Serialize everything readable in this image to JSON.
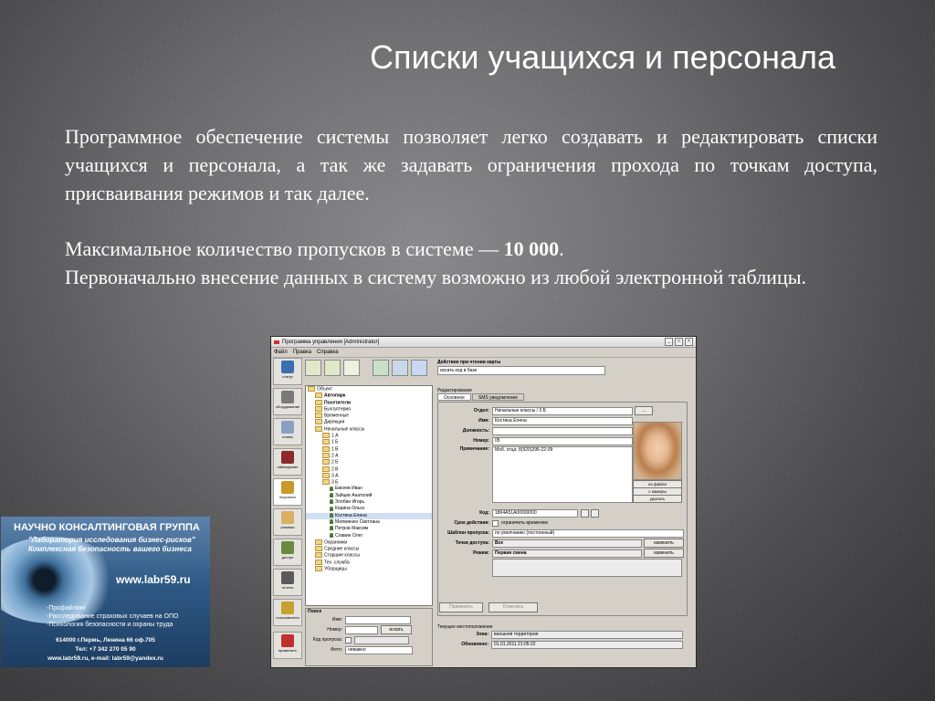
{
  "slide": {
    "title": "Списки учащихся и персонала",
    "paragraph1": "Программное обеспечение системы позволяет легко создавать и редактировать списки учащихся и персонала, а так же задавать ограничения прохода по точкам доступа, присваивания режимов и так далее.",
    "paragraph2_prefix": "Максимальное количество пропусков в системе — ",
    "paragraph2_value": "10 000",
    "paragraph2_suffix": ".",
    "paragraph3": "Первоначально внесение данных в систему возможно из любой электронной таблицы."
  },
  "app": {
    "window_title": "Программа управления [Administrator]",
    "window_buttons": [
      "_",
      "□",
      "×"
    ],
    "menu": [
      "Файл",
      "Правка",
      "Справка"
    ],
    "sidebar": [
      {
        "label": "статус",
        "icon": "status-icon",
        "color": "#3a6fb0"
      },
      {
        "label": "оборудование",
        "icon": "equipment-icon",
        "color": "#7a7a7a"
      },
      {
        "label": "планы",
        "icon": "plans-icon",
        "color": "#8aa0c0"
      },
      {
        "label": "наблюдение",
        "icon": "camera-icon",
        "color": "#8b2a2a"
      },
      {
        "label": "персонал",
        "icon": "people-icon",
        "color": "#c89a2a"
      },
      {
        "label": "режимы",
        "icon": "modes-icon",
        "color": "#d8b060"
      },
      {
        "label": "доступ",
        "icon": "access-icon",
        "color": "#6a8a40"
      },
      {
        "label": "отчеты",
        "icon": "reports-icon",
        "color": "#5a5a5a"
      },
      {
        "label": "пользователи",
        "icon": "keys-icon",
        "color": "#c8a030"
      },
      {
        "label": "применить",
        "icon": "apply-icon",
        "color": "#c03030"
      }
    ],
    "action": {
      "label": "Действие при чтении карты",
      "value": "искать код в базе"
    },
    "tree": [
      {
        "t": "Объект",
        "lvl": 0,
        "kind": "folder"
      },
      {
        "t": "Автопарк",
        "lvl": 1,
        "kind": "folder"
      },
      {
        "t": "Посетители",
        "lvl": 1,
        "kind": "folder"
      },
      {
        "t": "Бухгалтерия",
        "lvl": 1,
        "kind": "folder"
      },
      {
        "t": "Временные",
        "lvl": 1,
        "kind": "folder"
      },
      {
        "t": "Дирекция",
        "lvl": 1,
        "kind": "folder"
      },
      {
        "t": "Начальные классы",
        "lvl": 1,
        "kind": "folder"
      },
      {
        "t": "1 А",
        "lvl": 2,
        "kind": "folder"
      },
      {
        "t": "1 Б",
        "lvl": 2,
        "kind": "folder"
      },
      {
        "t": "1 В",
        "lvl": 2,
        "kind": "folder"
      },
      {
        "t": "2 А",
        "lvl": 2,
        "kind": "folder"
      },
      {
        "t": "2 Б",
        "lvl": 2,
        "kind": "folder"
      },
      {
        "t": "2 В",
        "lvl": 2,
        "kind": "folder"
      },
      {
        "t": "3 А",
        "lvl": 2,
        "kind": "folder"
      },
      {
        "t": "3 Б",
        "lvl": 2,
        "kind": "folder"
      },
      {
        "t": "Евсеев Иван",
        "lvl": 3,
        "kind": "person"
      },
      {
        "t": "Зайцев Анатолий",
        "lvl": 3,
        "kind": "person"
      },
      {
        "t": "Злобин Игорь",
        "lvl": 3,
        "kind": "person"
      },
      {
        "t": "Карина Ольга",
        "lvl": 3,
        "kind": "person"
      },
      {
        "t": "Костина Елена",
        "lvl": 3,
        "kind": "person",
        "selected": true
      },
      {
        "t": "Матвиенко Светлана",
        "lvl": 3,
        "kind": "person"
      },
      {
        "t": "Петров Максим",
        "lvl": 3,
        "kind": "person"
      },
      {
        "t": "Славин Олег",
        "lvl": 3,
        "kind": "person"
      },
      {
        "t": "Охранники",
        "lvl": 1,
        "kind": "folder"
      },
      {
        "t": "Средние классы",
        "lvl": 1,
        "kind": "folder"
      },
      {
        "t": "Старшие классы",
        "lvl": 1,
        "kind": "folder"
      },
      {
        "t": "Тех. служба",
        "lvl": 1,
        "kind": "folder"
      },
      {
        "t": "Уборщицы",
        "lvl": 1,
        "kind": "folder"
      }
    ],
    "search": {
      "title": "Поиск",
      "name_label": "Имя:",
      "number_label": "Номер:",
      "search_button": "искать",
      "pass_code_label": "Код пропуска:",
      "photo_label": "Фото:",
      "photo_value": "неважно"
    },
    "edit": {
      "title": "Редактирование",
      "tab_main": "Основное",
      "tab_sms": "SMS уведомление",
      "dept_label": "Отдел:",
      "dept_value": "Начальные классы / 3 Б",
      "dots": "...",
      "name_label": "Имя:",
      "name_value": "Костина Елена",
      "position_label": "Должность:",
      "position_value": "",
      "number_label": "Номер:",
      "number_value": "05",
      "note_label": "Примечание:",
      "note_value": "Моб. отца: 8(920)296-22-09",
      "photo_from_file": "из файла",
      "photo_from_camera": "с камеры",
      "photo_delete": "удалить",
      "code_label": "Код:",
      "code_value": "1804A51A00000000",
      "validity_label": "Срок действия:",
      "validity_value": "ограничить временем",
      "template_label": "Шаблон пропуска:",
      "template_value": "по умолчанию (постоянный)",
      "access_label": "Точки доступа:",
      "access_value": "Все",
      "mode_label": "Режим:",
      "mode_value": "Первая смена",
      "change": "изменить",
      "apply_button": "Применить",
      "cancel_button": "Отменить"
    },
    "location": {
      "title": "Текущее местоположение",
      "zone_label": "Зона:",
      "zone_value": "внешняя территория",
      "update_label": "Обновлено:",
      "update_value": "01.01.2011 21:05:22"
    }
  },
  "ad": {
    "line1": "НАУЧНО КОНСАЛТИНГОВАЯ ГРУППА",
    "line2": "\"Лаборатория исследования бизнес-рисков\"",
    "line3": "Комплексная безопасность вашего бизнеса",
    "url": "www.labr59.ru",
    "bullet1": "-Профайлинг",
    "bullet2": "-Расследование страховых случаев на ОПО",
    "bullet3": "-Психология безопасности и охраны труда",
    "address": "614000 г.Пермь, Ленина 66 оф.705",
    "phone": "Тел: +7 342 270 05 90",
    "email": "www.labr59.ru, e-mail: labr59@yandex.ru"
  }
}
